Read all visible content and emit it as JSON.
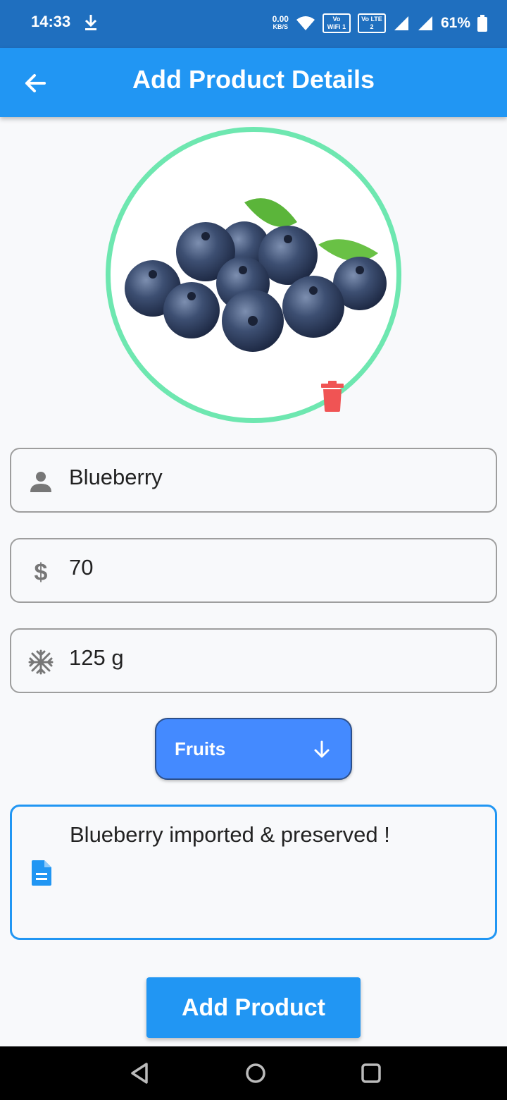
{
  "status_bar": {
    "time": "14:33",
    "net_speed_value": "0.00",
    "net_speed_unit": "KB/S",
    "vowifi_label": "Vo WiFi 1",
    "volte_label": "Vo LTE 2",
    "battery": "61%",
    "icons": [
      "download-icon",
      "wifi-icon",
      "signal-icon",
      "battery-icon"
    ]
  },
  "app_bar": {
    "title": "Add Product Details",
    "back_icon": "arrow-left-icon"
  },
  "product_image": {
    "subject": "blueberries",
    "delete_icon": "trash-icon",
    "ring_color": "#6ee7b0",
    "delete_color": "#f05454"
  },
  "form": {
    "name": {
      "value": "Blueberry",
      "icon": "person-icon"
    },
    "price": {
      "value": "70",
      "icon": "dollar-icon"
    },
    "quantity": {
      "value": "125 g",
      "icon": "snowflake-icon"
    },
    "category": {
      "selected": "Fruits",
      "icon": "arrow-down-icon"
    },
    "description": {
      "value": "Blueberry imported & preserved !",
      "icon": "document-icon"
    }
  },
  "actions": {
    "add_product_label": "Add Product"
  },
  "colors": {
    "primary": "#2196f3",
    "status_bar": "#1f6fbf",
    "dropdown": "#448aff"
  },
  "nav_bar": {
    "icons": [
      "back-triangle-icon",
      "home-circle-icon",
      "recents-square-icon"
    ]
  }
}
